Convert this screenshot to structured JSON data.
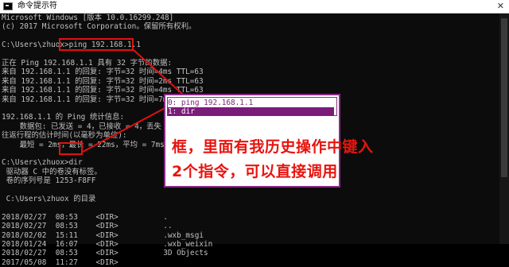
{
  "window": {
    "title": "命令提示符",
    "close_glyph": "✕"
  },
  "console": {
    "lines": [
      "Microsoft Windows [版本 10.0.16299.248]",
      "(c) 2017 Microsoft Corporation。保留所有权利。",
      "",
      "C:\\Users\\zhuox>ping 192.168.1.1",
      "",
      "正在 Ping 192.168.1.1 具有 32 字节的数据:",
      "来自 192.168.1.1 的回复: 字节=32 时间=4ms TTL=63",
      "来自 192.168.1.1 的回复: 字节=32 时间=2ms TTL=63",
      "来自 192.168.1.1 的回复: 字节=32 时间=4ms TTL=63",
      "来自 192.168.1.1 的回复: 字节=32 时间=7ms TTL=63",
      "",
      "192.168.1.1 的 Ping 统计信息:",
      "    数据包: 已发送 = 4，已接收 = 4，丢失",
      "往返行程的估计时间(以毫秒为单位):",
      "    最短 = 2ms，最长 = 22ms，平均 = 7ms",
      "",
      "C:\\Users\\zhuox>dir",
      " 驱动器 C 中的卷没有标签。",
      " 卷的序列号是 1253-F8FF",
      "",
      " C:\\Users\\zhuox 的目录",
      "",
      "2018/02/27  08:53    <DIR>          .",
      "2018/02/27  08:53    <DIR>          ..",
      "2018/02/02  15:11    <DIR>          .wxb_msgi",
      "2018/01/24  16:07    <DIR>          .wxb_weixin",
      "2018/02/27  08:53    <DIR>          3D Objects",
      "2017/05/08  11:27    <DIR>"
    ]
  },
  "history": {
    "items": [
      "0: ping 192.168.1.1",
      "1: dir"
    ],
    "selected_index": 1
  },
  "annotation": {
    "text": "框，里面有我历史操作中键入2个指令，可以直接调用",
    "color": "#e8140f"
  }
}
